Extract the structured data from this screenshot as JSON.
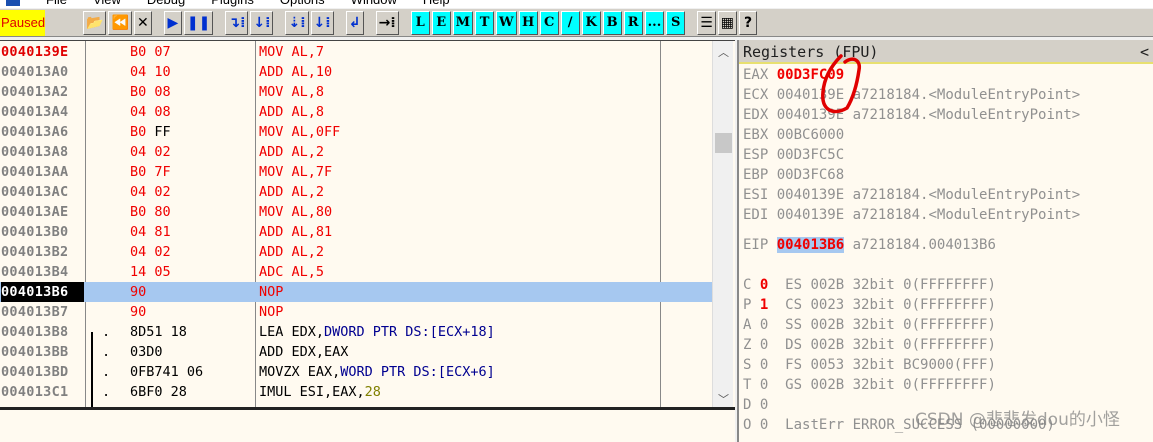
{
  "menu": [
    "File",
    "View",
    "Debug",
    "Plugins",
    "Options",
    "Window",
    "Help"
  ],
  "toolbar": {
    "status": "Paused",
    "buttons": [
      {
        "name": "open",
        "glyph": "📂",
        "cls": ""
      },
      {
        "name": "restart",
        "glyph": "⏪",
        "cls": ""
      },
      {
        "name": "close",
        "glyph": "✕",
        "cls": ""
      },
      {
        "gap": true
      },
      {
        "name": "run",
        "glyph": "▶",
        "cls": "blue"
      },
      {
        "name": "pause",
        "glyph": "❚❚",
        "cls": "blue"
      },
      {
        "gap": true
      },
      {
        "name": "step-into",
        "glyph": "↴⁞",
        "cls": "blue"
      },
      {
        "name": "step-over",
        "glyph": "↓⁞",
        "cls": "blue"
      },
      {
        "gap": true
      },
      {
        "name": "trace-into",
        "glyph": "⇣⁞",
        "cls": "blue"
      },
      {
        "name": "trace-over",
        "glyph": "↓⁞",
        "cls": "blue"
      },
      {
        "gap": true
      },
      {
        "name": "execute-till-return",
        "glyph": "↲",
        "cls": "blue"
      },
      {
        "gap": true
      },
      {
        "name": "go-to",
        "glyph": "→⁞",
        "cls": ""
      },
      {
        "gap": true
      },
      {
        "name": "L",
        "glyph": "L",
        "cls": "cyan"
      },
      {
        "name": "E",
        "glyph": "E",
        "cls": "cyan"
      },
      {
        "name": "M",
        "glyph": "M",
        "cls": "cyan"
      },
      {
        "name": "T",
        "glyph": "T",
        "cls": "cyan"
      },
      {
        "name": "W",
        "glyph": "W",
        "cls": "cyan"
      },
      {
        "name": "H",
        "glyph": "H",
        "cls": "cyan"
      },
      {
        "name": "C",
        "glyph": "C",
        "cls": "cyan"
      },
      {
        "name": "slash",
        "glyph": "/",
        "cls": "cyan"
      },
      {
        "name": "K",
        "glyph": "K",
        "cls": "cyan"
      },
      {
        "name": "B",
        "glyph": "B",
        "cls": "cyan"
      },
      {
        "name": "R",
        "glyph": "R",
        "cls": "cyan"
      },
      {
        "name": "dots",
        "glyph": "...",
        "cls": "cyan"
      },
      {
        "name": "S",
        "glyph": "S",
        "cls": "cyan"
      },
      {
        "gap": true
      },
      {
        "name": "list",
        "glyph": "☰",
        "cls": ""
      },
      {
        "name": "colors",
        "glyph": "▦",
        "cls": ""
      },
      {
        "name": "help",
        "glyph": "?",
        "cls": ""
      }
    ]
  },
  "colors": {
    "red": "#f00000",
    "black": "#000000",
    "navy": "#000090",
    "olive": "#808000",
    "selection": "#a6c8f0"
  },
  "code": {
    "rows": [
      {
        "addr": "0040139E",
        "cur": true,
        "mark": "",
        "hex": [
          [
            "B0 07",
            "red"
          ]
        ],
        "dis": [
          [
            "MOV AL,7",
            "red"
          ]
        ]
      },
      {
        "addr": "004013A0",
        "mark": "",
        "hex": [
          [
            "04 10",
            "red"
          ]
        ],
        "dis": [
          [
            "ADD AL,10",
            "red"
          ]
        ]
      },
      {
        "addr": "004013A2",
        "mark": "",
        "hex": [
          [
            "B0 08",
            "red"
          ]
        ],
        "dis": [
          [
            "MOV AL,8",
            "red"
          ]
        ]
      },
      {
        "addr": "004013A4",
        "mark": "",
        "hex": [
          [
            "04 08",
            "red"
          ]
        ],
        "dis": [
          [
            "ADD AL,8",
            "red"
          ]
        ]
      },
      {
        "addr": "004013A6",
        "mark": "",
        "hex": [
          [
            "B0 ",
            "red"
          ],
          [
            "FF",
            "black"
          ]
        ],
        "dis": [
          [
            "MOV AL,0FF",
            "red"
          ]
        ]
      },
      {
        "addr": "004013A8",
        "mark": "",
        "hex": [
          [
            "04 02",
            "red"
          ]
        ],
        "dis": [
          [
            "ADD AL,2",
            "red"
          ]
        ]
      },
      {
        "addr": "004013AA",
        "mark": "",
        "hex": [
          [
            "B0 7F",
            "red"
          ]
        ],
        "dis": [
          [
            "MOV AL,7F",
            "red"
          ]
        ]
      },
      {
        "addr": "004013AC",
        "mark": "",
        "hex": [
          [
            "04 02",
            "red"
          ]
        ],
        "dis": [
          [
            "ADD AL,2",
            "red"
          ]
        ]
      },
      {
        "addr": "004013AE",
        "mark": "",
        "hex": [
          [
            "B0 80",
            "red"
          ]
        ],
        "dis": [
          [
            "MOV AL,80",
            "red"
          ]
        ]
      },
      {
        "addr": "004013B0",
        "mark": "",
        "hex": [
          [
            "04 81",
            "red"
          ]
        ],
        "dis": [
          [
            "ADD AL,81",
            "red"
          ]
        ]
      },
      {
        "addr": "004013B2",
        "mark": "",
        "hex": [
          [
            "04 02",
            "red"
          ]
        ],
        "dis": [
          [
            "ADD AL,2",
            "red"
          ]
        ]
      },
      {
        "addr": "004013B4",
        "mark": "",
        "hex": [
          [
            "14 05",
            "red"
          ]
        ],
        "dis": [
          [
            "ADC AL,5",
            "red"
          ]
        ]
      },
      {
        "addr": "004013B6",
        "eip": true,
        "mark": "",
        "hex": [
          [
            "90",
            "red"
          ]
        ],
        "dis": [
          [
            "NOP",
            "red"
          ]
        ]
      },
      {
        "addr": "004013B7",
        "mark": "",
        "hex": [
          [
            "90",
            "red"
          ]
        ],
        "dis": [
          [
            "NOP",
            "red"
          ]
        ]
      },
      {
        "addr": "004013B8",
        "mark": ".",
        "hex": [
          [
            "8D51 18",
            "black"
          ]
        ],
        "dis": [
          [
            "LEA EDX,",
            "black"
          ],
          [
            "DWORD PTR DS:[ECX+18]",
            "navy"
          ]
        ]
      },
      {
        "addr": "004013BB",
        "mark": ".",
        "hex": [
          [
            "03D0",
            "black"
          ]
        ],
        "dis": [
          [
            "ADD EDX,EAX",
            "black"
          ]
        ]
      },
      {
        "addr": "004013BD",
        "mark": ".",
        "hex": [
          [
            "0FB741 06",
            "black"
          ]
        ],
        "dis": [
          [
            "MOVZX EAX,",
            "black"
          ],
          [
            "WORD PTR DS:[ECX+6]",
            "navy"
          ]
        ]
      },
      {
        "addr": "004013C1",
        "mark": ".",
        "hex": [
          [
            "6BF0 28",
            "black"
          ]
        ],
        "dis": [
          [
            "IMUL ESI,EAX,",
            "black"
          ],
          [
            "28",
            "olive"
          ]
        ]
      }
    ]
  },
  "registers": {
    "title": "Registers (FPU)",
    "collapse": "<",
    "gp": [
      {
        "name": "EAX",
        "value": "00D3FC09",
        "changed": true,
        "comment": ""
      },
      {
        "name": "ECX",
        "value": "0040139E",
        "comment": "a7218184.<ModuleEntryPoint>"
      },
      {
        "name": "EDX",
        "value": "0040139E",
        "comment": "a7218184.<ModuleEntryPoint>"
      },
      {
        "name": "EBX",
        "value": "00BC6000",
        "comment": ""
      },
      {
        "name": "ESP",
        "value": "00D3FC5C",
        "comment": ""
      },
      {
        "name": "EBP",
        "value": "00D3FC68",
        "comment": ""
      },
      {
        "name": "ESI",
        "value": "0040139E",
        "comment": "a7218184.<ModuleEntryPoint>"
      },
      {
        "name": "EDI",
        "value": "0040139E",
        "comment": "a7218184.<ModuleEntryPoint>"
      }
    ],
    "eip": {
      "name": "EIP",
      "value": "004013B6",
      "comment": "a7218184.004013B6"
    },
    "flags": [
      {
        "flag": "C",
        "value": "0",
        "changed": true,
        "seg": "ES 002B 32bit 0(FFFFFFFF)"
      },
      {
        "flag": "P",
        "value": "1",
        "changed": true,
        "seg": "CS 0023 32bit 0(FFFFFFFF)"
      },
      {
        "flag": "A",
        "value": "0",
        "seg": "SS 002B 32bit 0(FFFFFFFF)"
      },
      {
        "flag": "Z",
        "value": "0",
        "seg": "DS 002B 32bit 0(FFFFFFFF)"
      },
      {
        "flag": "S",
        "value": "0",
        "seg": "FS 0053 32bit BC9000(FFF)"
      },
      {
        "flag": "T",
        "value": "0",
        "seg": "GS 002B 32bit 0(FFFFFFFF)"
      },
      {
        "flag": "D",
        "value": "0",
        "seg": ""
      },
      {
        "flag": "O",
        "value": "0",
        "seg": "LastErr ERROR_SUCCESS (00000000)"
      }
    ]
  },
  "watermark": "CSDN @悲悲发dou的小怪"
}
